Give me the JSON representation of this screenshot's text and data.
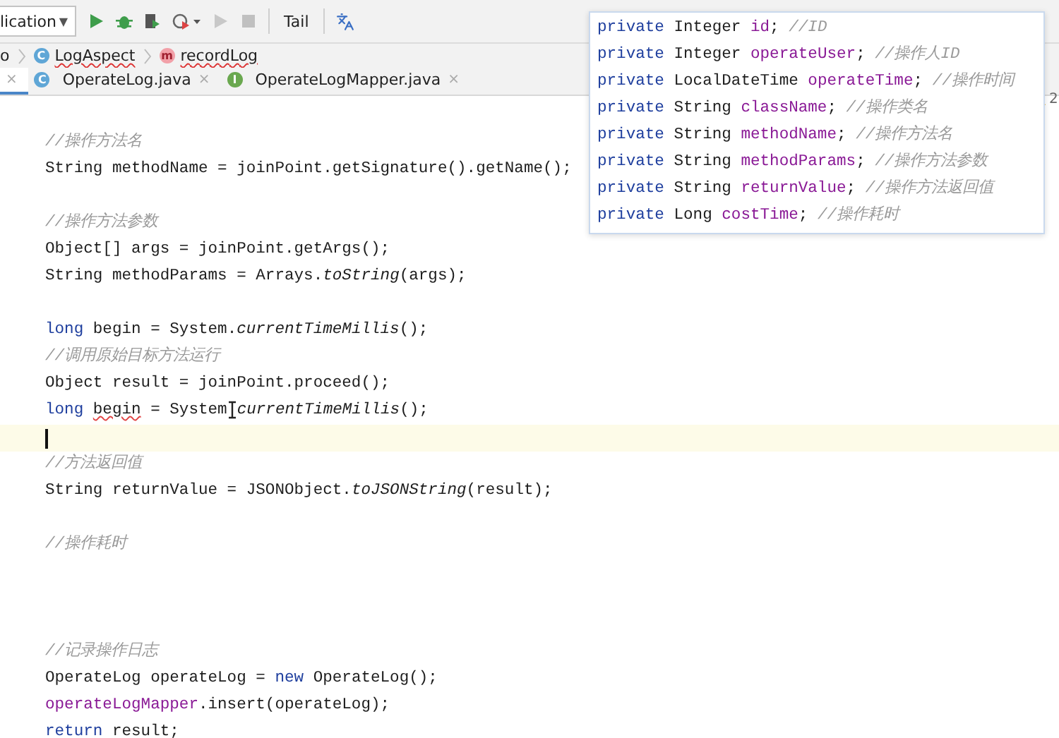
{
  "toolbar": {
    "config": "lication",
    "config_caret": "▼",
    "tail": "Tail"
  },
  "breadcrumbs": [
    {
      "text": "o"
    },
    {
      "kind": "class",
      "badge": "C",
      "text": "LogAspect",
      "error": true
    },
    {
      "kind": "method",
      "badge": "m",
      "text": "recordLog",
      "error": true
    }
  ],
  "tabs": [
    {
      "close": "×",
      "selected": true
    },
    {
      "kind": "class",
      "badge": "C",
      "label": "OperateLog.java",
      "close": "×",
      "selected": false
    },
    {
      "kind": "interface",
      "badge": "I",
      "label": "OperateLogMapper.java",
      "close": "×",
      "selected": false
    }
  ],
  "inspection": {
    "count": "2"
  },
  "editor": {
    "lines": [
      {
        "kind": "blank"
      },
      {
        "kind": "code",
        "tokens": [
          {
            "kind": "comment",
            "t": "//操作方法名"
          }
        ]
      },
      {
        "kind": "code",
        "tokens": [
          {
            "kind": "plain",
            "t": "String methodName = joinPoint.getSignature().getName();"
          }
        ]
      },
      {
        "kind": "blank"
      },
      {
        "kind": "code",
        "tokens": [
          {
            "kind": "comment",
            "t": "//操作方法参数"
          }
        ]
      },
      {
        "kind": "code",
        "tokens": [
          {
            "kind": "plain",
            "t": "Object[] args = joinPoint.getArgs();"
          }
        ]
      },
      {
        "kind": "code",
        "tokens": [
          {
            "kind": "plain",
            "t": "String methodParams = Arrays."
          },
          {
            "kind": "static",
            "t": "toString"
          },
          {
            "kind": "plain",
            "t": "(args);"
          }
        ]
      },
      {
        "kind": "blank"
      },
      {
        "kind": "code",
        "tokens": [
          {
            "kind": "keyword",
            "t": "long"
          },
          {
            "kind": "plain",
            "t": " begin = System."
          },
          {
            "kind": "static",
            "t": "currentTimeMillis"
          },
          {
            "kind": "plain",
            "t": "();"
          }
        ]
      },
      {
        "kind": "code",
        "tokens": [
          {
            "kind": "comment",
            "t": "//调用原始目标方法运行"
          }
        ]
      },
      {
        "kind": "code",
        "tokens": [
          {
            "kind": "plain",
            "t": "Object result = joinPoint.proceed();"
          }
        ]
      },
      {
        "kind": "code",
        "tokens": [
          {
            "kind": "keyword",
            "t": "long "
          },
          {
            "kind": "error",
            "t": "begin"
          },
          {
            "kind": "plain",
            "t": " = System"
          },
          {
            "kind": "pointer"
          },
          {
            "kind": "static",
            "t": "currentTimeMillis"
          },
          {
            "kind": "plain",
            "t": "();"
          }
        ]
      },
      {
        "kind": "cursor"
      },
      {
        "kind": "code",
        "tokens": [
          {
            "kind": "comment",
            "t": "//方法返回值"
          }
        ]
      },
      {
        "kind": "code",
        "tokens": [
          {
            "kind": "plain",
            "t": "String returnValue = JSONObject."
          },
          {
            "kind": "static",
            "t": "toJSONString"
          },
          {
            "kind": "plain",
            "t": "(result);"
          }
        ]
      },
      {
        "kind": "blank"
      },
      {
        "kind": "code",
        "tokens": [
          {
            "kind": "comment",
            "t": "//操作耗时"
          }
        ]
      },
      {
        "kind": "blank"
      },
      {
        "kind": "blank"
      },
      {
        "kind": "blank"
      },
      {
        "kind": "code",
        "tokens": [
          {
            "kind": "comment",
            "t": "//记录操作日志"
          }
        ]
      },
      {
        "kind": "code",
        "tokens": [
          {
            "kind": "plain",
            "t": "OperateLog operateLog = "
          },
          {
            "kind": "keyword",
            "t": "new"
          },
          {
            "kind": "plain",
            "t": " OperateLog();"
          }
        ]
      },
      {
        "kind": "code",
        "tokens": [
          {
            "kind": "field",
            "t": "operateLogMapper"
          },
          {
            "kind": "plain",
            "t": ".insert(operateLog);"
          }
        ]
      },
      {
        "kind": "code",
        "tokens": [
          {
            "kind": "keyword",
            "t": "return"
          },
          {
            "kind": "plain",
            "t": " result;"
          }
        ]
      }
    ]
  },
  "popup": {
    "lines": [
      {
        "tokens": [
          {
            "kind": "keyword",
            "t": "private"
          },
          {
            "kind": "plain",
            "t": " Integer "
          },
          {
            "kind": "field",
            "t": "id"
          },
          {
            "kind": "plain",
            "t": "; "
          },
          {
            "kind": "comment",
            "t": "//ID"
          }
        ]
      },
      {
        "tokens": [
          {
            "kind": "keyword",
            "t": "private"
          },
          {
            "kind": "plain",
            "t": " Integer "
          },
          {
            "kind": "field",
            "t": "operateUser"
          },
          {
            "kind": "plain",
            "t": "; "
          },
          {
            "kind": "comment",
            "t": "//操作人ID"
          }
        ]
      },
      {
        "tokens": [
          {
            "kind": "keyword",
            "t": "private"
          },
          {
            "kind": "plain",
            "t": " LocalDateTime "
          },
          {
            "kind": "field",
            "t": "operateTime"
          },
          {
            "kind": "plain",
            "t": "; "
          },
          {
            "kind": "comment",
            "t": "//操作时间"
          }
        ]
      },
      {
        "tokens": [
          {
            "kind": "keyword",
            "t": "private"
          },
          {
            "kind": "plain",
            "t": " String "
          },
          {
            "kind": "field",
            "t": "className"
          },
          {
            "kind": "plain",
            "t": "; "
          },
          {
            "kind": "comment",
            "t": "//操作类名"
          }
        ]
      },
      {
        "tokens": [
          {
            "kind": "keyword",
            "t": "private"
          },
          {
            "kind": "plain",
            "t": " String "
          },
          {
            "kind": "field",
            "t": "methodName"
          },
          {
            "kind": "plain",
            "t": "; "
          },
          {
            "kind": "comment",
            "t": "//操作方法名"
          }
        ]
      },
      {
        "tokens": [
          {
            "kind": "keyword",
            "t": "private"
          },
          {
            "kind": "plain",
            "t": " String "
          },
          {
            "kind": "field",
            "t": "methodParams"
          },
          {
            "kind": "plain",
            "t": "; "
          },
          {
            "kind": "comment",
            "t": "//操作方法参数"
          }
        ]
      },
      {
        "tokens": [
          {
            "kind": "keyword",
            "t": "private"
          },
          {
            "kind": "plain",
            "t": " String "
          },
          {
            "kind": "field",
            "t": "returnValue"
          },
          {
            "kind": "plain",
            "t": "; "
          },
          {
            "kind": "comment",
            "t": "//操作方法返回值"
          }
        ]
      },
      {
        "tokens": [
          {
            "kind": "keyword",
            "t": "private"
          },
          {
            "kind": "plain",
            "t": " Long "
          },
          {
            "kind": "field",
            "t": "costTime"
          },
          {
            "kind": "plain",
            "t": "; "
          },
          {
            "kind": "comment",
            "t": "//操作耗时"
          }
        ]
      }
    ]
  }
}
